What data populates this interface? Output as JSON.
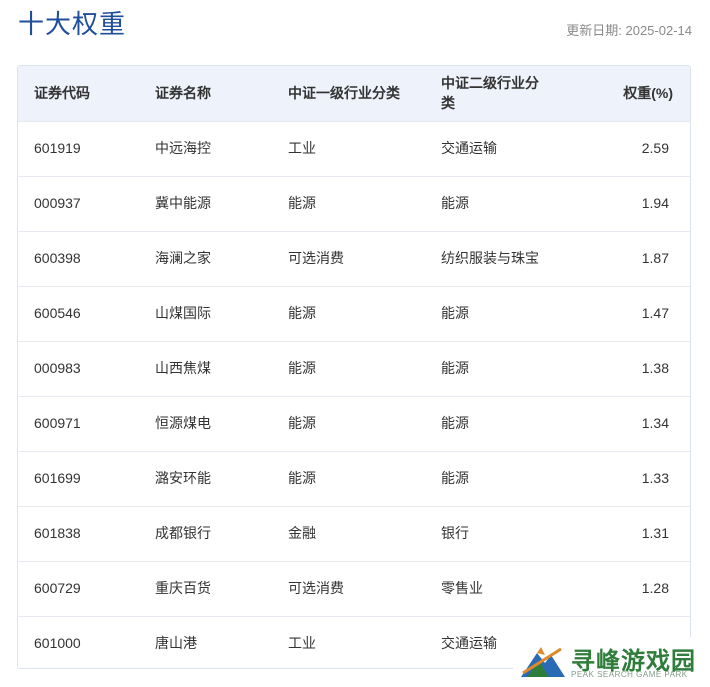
{
  "page": {
    "title": "十大权重",
    "update_label": "更新日期: 2025-02-14"
  },
  "table": {
    "headers": [
      "证券代码",
      "证券名称",
      "中证一级行业分类",
      "中证二级行业分类",
      "权重(%)"
    ],
    "rows": [
      {
        "code": "601919",
        "name": "中远海控",
        "level1": "工业",
        "level2": "交通运输",
        "weight": "2.59"
      },
      {
        "code": "000937",
        "name": "冀中能源",
        "level1": "能源",
        "level2": "能源",
        "weight": "1.94"
      },
      {
        "code": "600398",
        "name": "海澜之家",
        "level1": "可选消费",
        "level2": "纺织服装与珠宝",
        "weight": "1.87"
      },
      {
        "code": "600546",
        "name": "山煤国际",
        "level1": "能源",
        "level2": "能源",
        "weight": "1.47"
      },
      {
        "code": "000983",
        "name": "山西焦煤",
        "level1": "能源",
        "level2": "能源",
        "weight": "1.38"
      },
      {
        "code": "600971",
        "name": "恒源煤电",
        "level1": "能源",
        "level2": "能源",
        "weight": "1.34"
      },
      {
        "code": "601699",
        "name": "潞安环能",
        "level1": "能源",
        "level2": "能源",
        "weight": "1.33"
      },
      {
        "code": "601838",
        "name": "成都银行",
        "level1": "金融",
        "level2": "银行",
        "weight": "1.31"
      },
      {
        "code": "600729",
        "name": "重庆百货",
        "level1": "可选消费",
        "level2": "零售业",
        "weight": "1.28"
      },
      {
        "code": "601000",
        "name": "唐山港",
        "level1": "工业",
        "level2": "交通运输",
        "weight": ""
      }
    ]
  },
  "watermark": {
    "main": "寻峰游戏园",
    "sub": "PEAK SEARCH GAME PARK",
    "colors": {
      "green": "#2f7d3b",
      "blue": "#2a6bb5",
      "orange": "#e0892a"
    }
  },
  "colors": {
    "title": "#1f4e9a",
    "header_bg": "#eef2fb",
    "border": "#dde3ee"
  }
}
